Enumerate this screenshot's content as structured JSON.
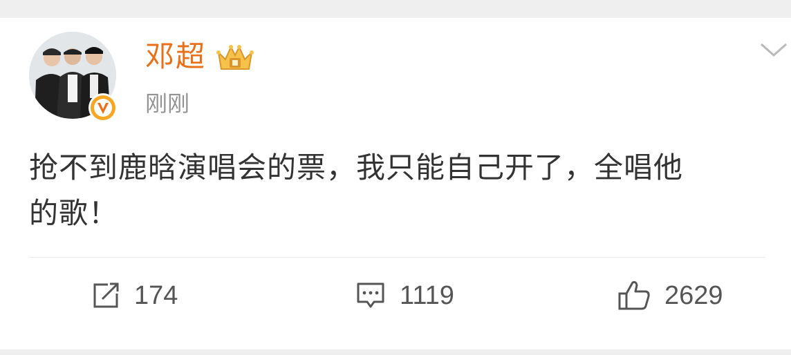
{
  "post": {
    "author": "邓超",
    "time": "刚刚",
    "text_line1": "抢不到鹿晗演唱会的票，我只能自己开了，全唱他",
    "text_line2": "的歌！"
  },
  "actions": {
    "repost_count": "174",
    "comment_count": "1119",
    "like_count": "2629"
  },
  "colors": {
    "username": "#e8701a",
    "verified": "#f5a623",
    "text": "#333333",
    "muted": "#939393"
  },
  "icons": {
    "avatar": "profile-photo",
    "verified": "verified-v-icon",
    "crown": "crown-level-icon",
    "menu": "chevron-down-icon",
    "repost": "repost-icon",
    "comment": "comment-icon",
    "like": "thumbs-up-icon"
  }
}
